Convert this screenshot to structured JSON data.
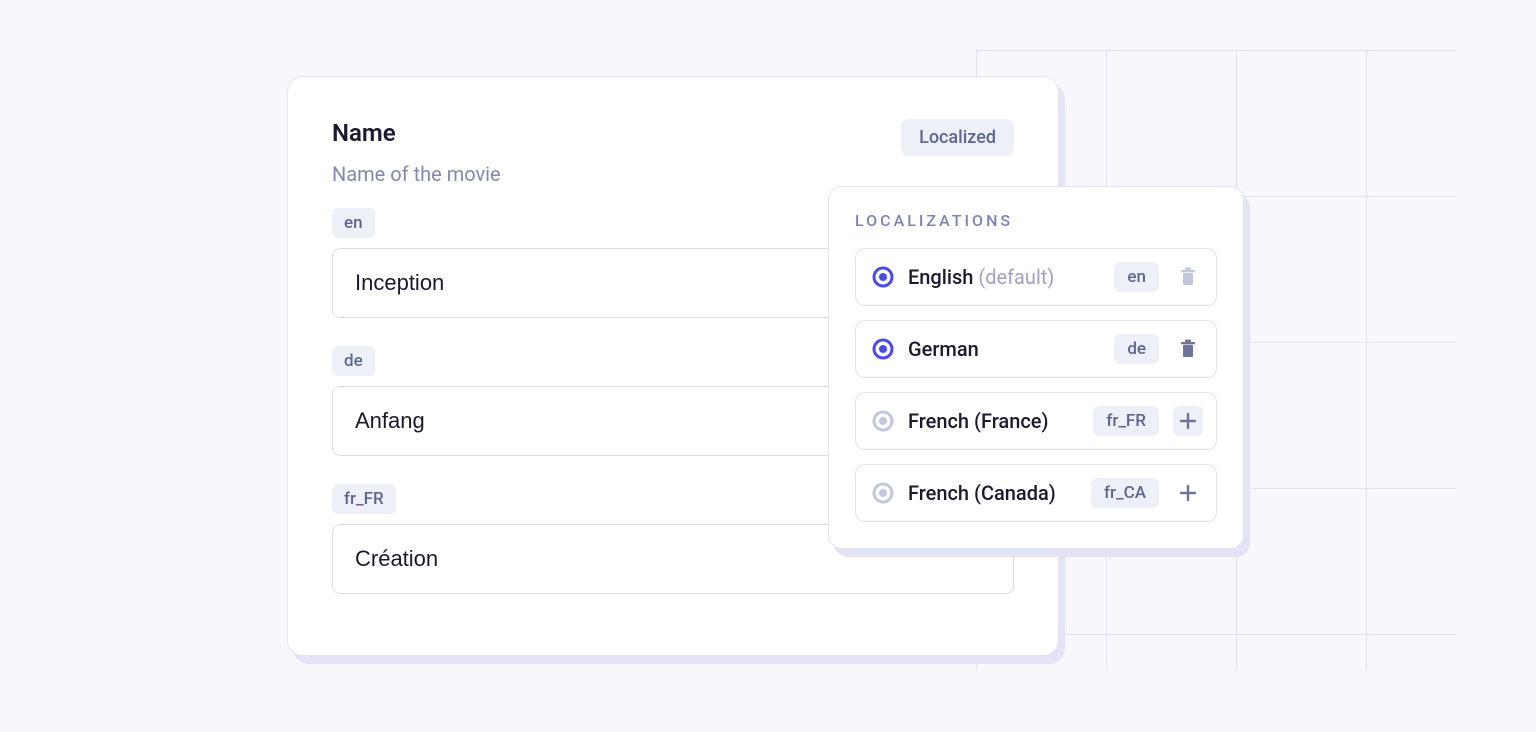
{
  "field": {
    "title": "Name",
    "description": "Name of the movie",
    "badge": "Localized",
    "entries": [
      {
        "code": "en",
        "value": "Inception"
      },
      {
        "code": "de",
        "value": "Anfang"
      },
      {
        "code": "fr_FR",
        "value": "Création"
      }
    ]
  },
  "popover": {
    "title": "LOCALIZATIONS",
    "items": [
      {
        "name": "English",
        "suffix": "(default)",
        "code": "en",
        "selected": true,
        "action": "delete",
        "deletable": false
      },
      {
        "name": "German",
        "suffix": "",
        "code": "de",
        "selected": true,
        "action": "delete",
        "deletable": true
      },
      {
        "name": "French (France)",
        "suffix": "",
        "code": "fr_FR",
        "selected": false,
        "action": "add",
        "highlighted": true
      },
      {
        "name": "French (Canada)",
        "suffix": "",
        "code": "fr_CA",
        "selected": false,
        "action": "add",
        "highlighted": false
      }
    ]
  }
}
